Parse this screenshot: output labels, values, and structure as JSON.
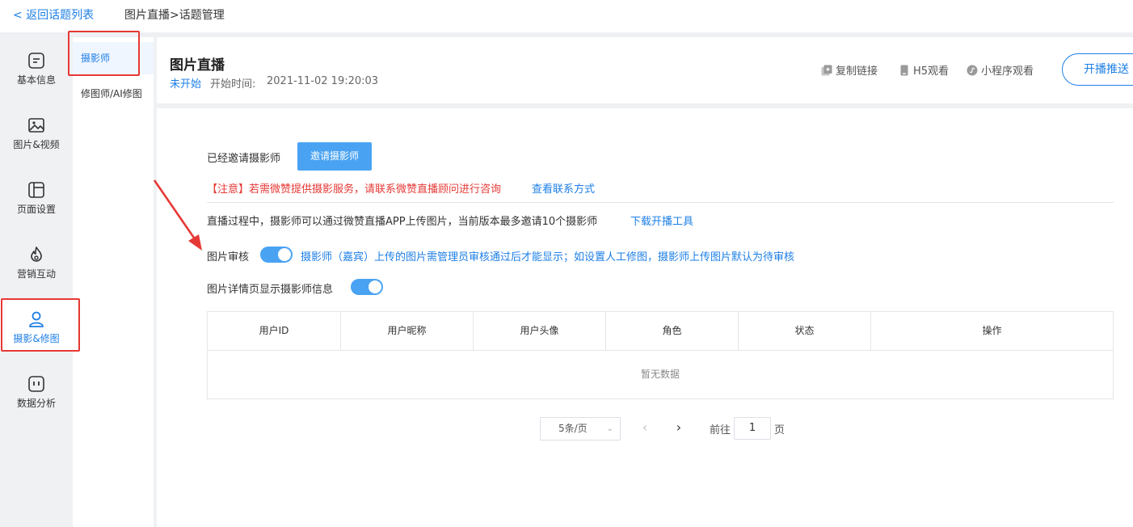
{
  "topbar": {
    "back_label": "< 返回话题列表",
    "breadcrumb": "图片直播>话题管理"
  },
  "sidebar": {
    "items": [
      {
        "label": "基本信息",
        "icon": "info-icon"
      },
      {
        "label": "图片&视频",
        "icon": "image-icon"
      },
      {
        "label": "页面设置",
        "icon": "layout-icon"
      },
      {
        "label": "营销互动",
        "icon": "fire-icon"
      },
      {
        "label": "摄影&修图",
        "icon": "user-icon",
        "active": true
      },
      {
        "label": "数据分析",
        "icon": "chart-icon"
      }
    ]
  },
  "submenu": {
    "items": [
      {
        "label": "摄影师",
        "active": true
      },
      {
        "label": "修图师/AI修图"
      }
    ]
  },
  "header": {
    "title": "图片直播",
    "status": "未开始",
    "time_label": "开始时间:",
    "time_value": "2021-11-02 19:20:03",
    "actions": {
      "copy_link": "复制链接",
      "h5_view": "H5观看",
      "mini_view": "小程序观看",
      "push": "开播推送"
    }
  },
  "main": {
    "invited_label": "已经邀请摄影师",
    "invite_button": "邀请摄影师",
    "notice": "【注意】若需微赞提供摄影服务，请联系微赞直播顾问进行咨询",
    "notice_link": "查看联系方式",
    "description": "直播过程中，摄影师可以通过微赞直播APP上传图片，当前版本最多邀请10个摄影师",
    "description_link": "下载开播工具",
    "review_label": "图片审核",
    "review_hint": "摄影师（嘉宾）上传的图片需管理员审核通过后才能显示；如设置人工修图，摄影师上传图片默认为待审核",
    "review_enabled": true,
    "show_info_label": "图片详情页显示摄影师信息",
    "show_info_enabled": true
  },
  "table": {
    "columns": [
      "用户ID",
      "用户昵称",
      "用户头像",
      "角色",
      "状态",
      "操作"
    ],
    "empty_text": "暂无数据"
  },
  "pagination": {
    "page_size": "5条/页",
    "goto_label": "前往",
    "current_page": "1",
    "page_unit": "页"
  },
  "colors": {
    "accent": "#1e7fe6",
    "button": "#4aa3f2",
    "warning": "#e53935"
  }
}
